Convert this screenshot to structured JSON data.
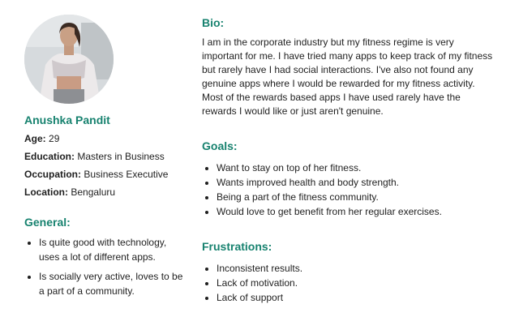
{
  "profile": {
    "name": "Anushka Pandit",
    "age_label": "Age:",
    "age": "29",
    "education_label": "Education:",
    "education": "Masters in Business",
    "occupation_label": "Occupation:",
    "occupation": "Business Executive",
    "location_label": "Location:",
    "location": "Bengaluru"
  },
  "general": {
    "heading": "General:",
    "items": [
      "Is quite good with technology, uses a lot of different apps.",
      "Is socially very active, loves to be a part of a community."
    ]
  },
  "bio": {
    "heading": "Bio:",
    "text": "I am in the corporate industry but my fitness regime is very important for me. I have tried many apps to keep track of my fitness but rarely have I had social interactions. I've also not found any genuine apps where I would be rewarded for my fitness activity. Most of the rewards based apps I have used rarely have the rewards I would like or just aren't genuine."
  },
  "goals": {
    "heading": "Goals:",
    "items": [
      "Want to stay on top of her fitness.",
      "Wants improved health and body strength.",
      "Being a part of the fitness community.",
      "Would love to get benefit from her regular exercises."
    ]
  },
  "frustrations": {
    "heading": "Frustrations:",
    "items": [
      "Inconsistent results.",
      "Lack of motivation.",
      "Lack of support"
    ]
  }
}
